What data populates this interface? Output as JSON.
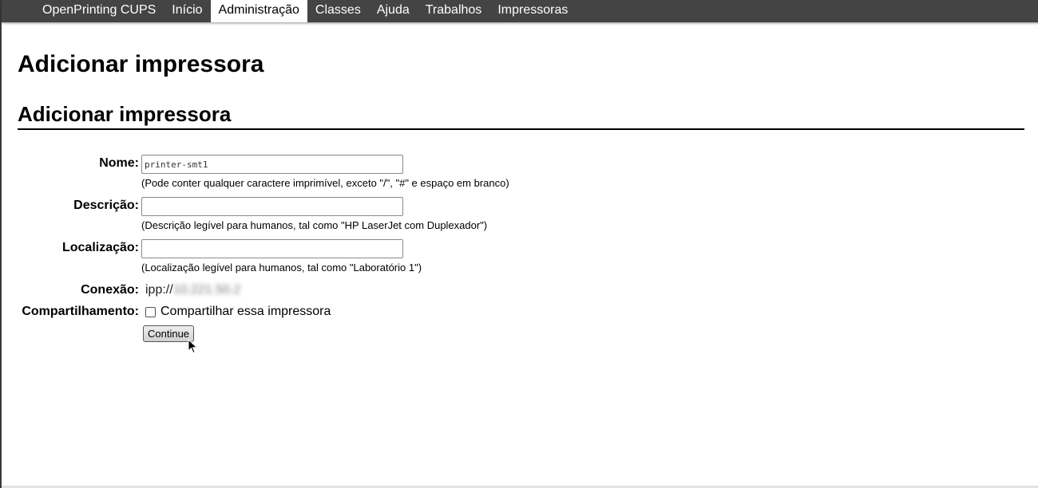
{
  "nav": {
    "items": [
      {
        "label": "OpenPrinting CUPS",
        "active": false
      },
      {
        "label": "Início",
        "active": false
      },
      {
        "label": "Administração",
        "active": true
      },
      {
        "label": "Classes",
        "active": false
      },
      {
        "label": "Ajuda",
        "active": false
      },
      {
        "label": "Trabalhos",
        "active": false
      },
      {
        "label": "Impressoras",
        "active": false
      }
    ]
  },
  "page": {
    "title": "Adicionar impressora",
    "section_title": "Adicionar impressora"
  },
  "form": {
    "name": {
      "label": "Nome:",
      "value": "printer-smt1",
      "hint": "(Pode conter qualquer caractere imprimível, exceto \"/\", \"#\" e espaço em branco)"
    },
    "description": {
      "label": "Descrição:",
      "value": "",
      "hint": "(Descrição legível para humanos, tal como \"HP LaserJet com Duplexador\")"
    },
    "location": {
      "label": "Localização:",
      "value": "",
      "hint": "(Localização legível para humanos, tal como \"Laboratório 1\")"
    },
    "connection": {
      "label": "Conexão:",
      "prefix": "ipp://",
      "value_redacted": "10.221.50.2"
    },
    "sharing": {
      "label": "Compartilhamento:",
      "checkbox_label": "Compartilhar essa impressora",
      "checked": false
    },
    "submit_label": "Continue"
  }
}
